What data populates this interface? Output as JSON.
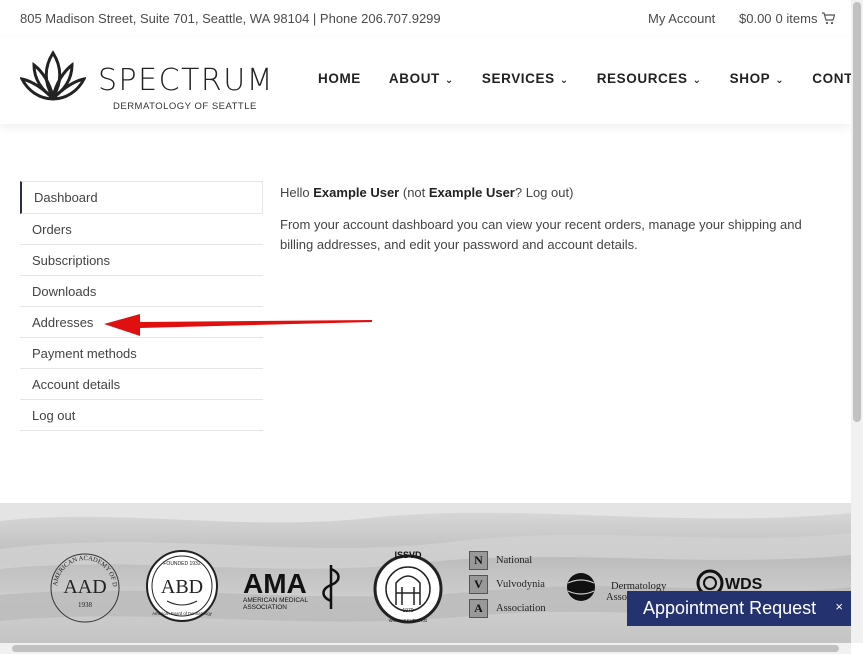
{
  "topbar": {
    "address": "805 Madison Street, Suite 701, Seattle, WA 98104 | Phone 206.707.9299",
    "my_account": "My Account",
    "cart_total": "$0.00",
    "cart_items": "0 items"
  },
  "brand": {
    "name": "SPECTRUM",
    "subtitle": "DERMATOLOGY OF SEATTLE"
  },
  "nav": [
    {
      "label": "HOME",
      "dropdown": false
    },
    {
      "label": "ABOUT",
      "dropdown": true
    },
    {
      "label": "SERVICES",
      "dropdown": true
    },
    {
      "label": "RESOURCES",
      "dropdown": true
    },
    {
      "label": "SHOP",
      "dropdown": true
    },
    {
      "label": "CONTACT",
      "dropdown": true
    }
  ],
  "account_nav": [
    {
      "label": "Dashboard"
    },
    {
      "label": "Orders"
    },
    {
      "label": "Subscriptions"
    },
    {
      "label": "Downloads"
    },
    {
      "label": "Addresses"
    },
    {
      "label": "Payment methods"
    },
    {
      "label": "Account details"
    },
    {
      "label": "Log out"
    }
  ],
  "dashboard": {
    "hello": "Hello ",
    "user": "Example User",
    "not": " (not ",
    "user2": "Example User",
    "logout": "? Log out)",
    "intro": "From your account dashboard you can view your recent orders, manage your shipping and billing addresses, and edit your password and account details."
  },
  "footer_logos": {
    "aad": "AAD",
    "aad_year": "1938",
    "aad_ring": "AMERICAN ACADEMY OF DERMATOLOGY",
    "abd": "ABD",
    "abd_founded": "FOUNDED 1932",
    "abd_ring": "American Board of Dermatology",
    "ama": "AMA",
    "ama_sub1": "AMERICAN MEDICAL",
    "ama_sub2": "ASSOCIATION",
    "issvd": "ISSVD",
    "issvd_year": "1970",
    "issvd_url": "WWW.ISSVD.ORG",
    "nva": [
      {
        "letter": "N",
        "word": "National"
      },
      {
        "letter": "V",
        "word": "Vulvodynia"
      },
      {
        "letter": "A",
        "word": "Association"
      }
    ],
    "derm": "Dermatology",
    "derm2": "Asso",
    "wds": "WDS"
  },
  "appointment": {
    "label": "Appointment Request",
    "close": "×"
  },
  "colors": {
    "accent": "#243270",
    "arrow": "#e01010"
  }
}
